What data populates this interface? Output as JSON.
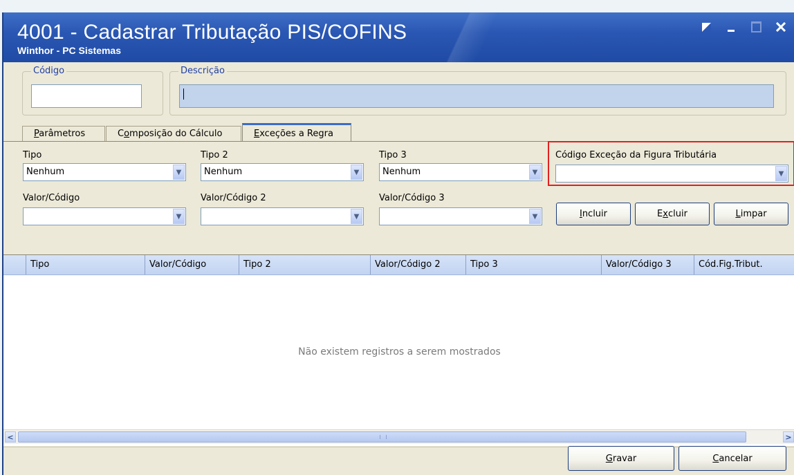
{
  "window": {
    "title": "4001 - Cadastrar Tributação PIS/COFINS",
    "subtitle": "Winthor - PC Sistemas",
    "controls": [
      "restore-icon",
      "minimize-icon",
      "maximize-icon",
      "close-icon"
    ],
    "accent": "#2a57b3"
  },
  "header": {
    "codigo_label": "Código",
    "codigo_value": "",
    "descricao_label": "Descrição",
    "descricao_value": ""
  },
  "tabs": [
    {
      "label_u": "P",
      "label_rest": "arâmetros"
    },
    {
      "label_pre": "C",
      "label_u": "o",
      "label_rest": "mposição do Cálculo"
    },
    {
      "label_u": "E",
      "label_rest": "xceções a Regra"
    }
  ],
  "filters": {
    "tipo_label": "Tipo",
    "tipo_value": "Nenhum",
    "tipo2_label": "Tipo 2",
    "tipo2_value": "Nenhum",
    "tipo3_label": "Tipo 3",
    "tipo3_value": "Nenhum",
    "codigo_excecao_label": "Código Exceção da Figura Tributária",
    "codigo_excecao_value": "",
    "valor_codigo_label": "Valor/Código",
    "valor_codigo2_label": "Valor/Código 2",
    "valor_codigo3_label": "Valor/Código 3"
  },
  "buttons": {
    "incluir_u": "I",
    "incluir_rest": "ncluir",
    "excluir_pre": "E",
    "excluir_u": "x",
    "excluir_rest": "cluir",
    "limpar_u": "L",
    "limpar_rest": "impar",
    "gravar_u": "G",
    "gravar_rest": "ravar",
    "cancelar_u": "C",
    "cancelar_rest": "ancelar"
  },
  "grid": {
    "columns": [
      "Tipo",
      "Valor/Código",
      "Tipo 2",
      "Valor/Código 2",
      "Tipo 3",
      "Valor/Código 3",
      "Cód.Fig.Tribut."
    ],
    "rows": [],
    "empty_message": "Não existem registros a serem mostrados"
  },
  "colors": {
    "highlight": "#e22020",
    "disabled_field": "#c2d3ec"
  }
}
